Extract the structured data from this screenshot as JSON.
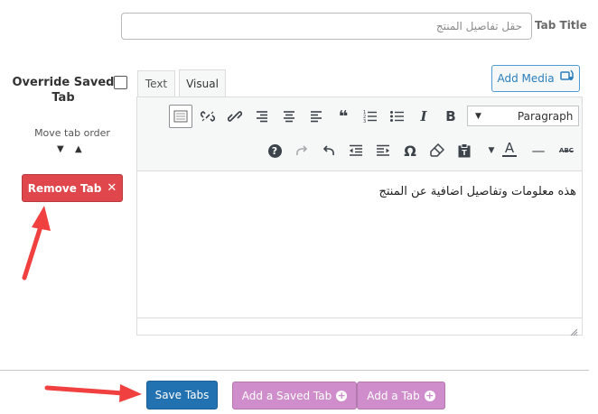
{
  "tab_title": {
    "label": "Tab Title",
    "placeholder": "حقل تفاصيل المنتج"
  },
  "left_panel": {
    "override_label": "Override Saved Tab",
    "move_order_label": "Move tab order",
    "move_down_arrow": "▼",
    "move_up_arrow": "▲",
    "remove_button_label": "Remove Tab",
    "remove_button_icon": "✕"
  },
  "editor": {
    "tabs": [
      {
        "label": "Text"
      },
      {
        "label": "Visual"
      }
    ],
    "add_media_label": "Add Media",
    "format_select_value": "Paragraph",
    "toolbar_row1_icons": [
      "toolbar-toggle-icon",
      "unlink-icon",
      "link-icon",
      "align-right-icon",
      "align-center-icon",
      "align-left-icon",
      "blockquote-icon",
      "numbered-list-icon",
      "bullet-list-icon",
      "italic-icon",
      "bold-icon"
    ],
    "toolbar_row2_icons": [
      "help-icon",
      "redo-icon",
      "undo-icon",
      "outdent-icon",
      "indent-icon",
      "special-character-icon",
      "clear-formatting-icon",
      "paste-as-text-icon",
      "text-color-icon",
      "horizontal-line-icon",
      "strikethrough-icon"
    ],
    "glyphs": {
      "blockquote": "❝",
      "italic": "I",
      "bold": "B",
      "help": "?",
      "omega": "Ω",
      "text_color": "A",
      "strikethrough": "ABC",
      "dash": "—"
    },
    "content": "هذه معلومات وتفاصيل اضافية عن المنتج"
  },
  "footer": {
    "save_label": "Save Tabs",
    "add_saved_label": "Add a Saved Tab",
    "add_tab_label": "Add a Tab",
    "plus_glyph": "+"
  },
  "colors": {
    "remove_button": "#e0474c",
    "save_button": "#2271b1",
    "purple_button": "#cf8ecb",
    "annotation_arrow": "#f0403f"
  }
}
